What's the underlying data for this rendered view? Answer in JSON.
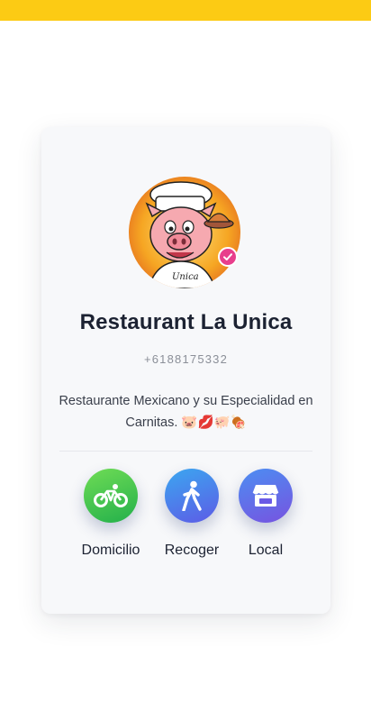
{
  "restaurant": {
    "name": "Restaurant La Unica",
    "phone": "+6188175332",
    "description": "Restaurante Mexicano y su Especialidad en Carnitas. 🐷💋🐖🍖",
    "logo_text": "Unica",
    "verified_icon": "check-badge-icon"
  },
  "actions": [
    {
      "label": "Domicilio",
      "icon": "bicycle-icon",
      "color": "#23b04b"
    },
    {
      "label": "Recoger",
      "icon": "walking-person-icon",
      "color": "#3ba7f0"
    },
    {
      "label": "Local",
      "icon": "storefront-icon",
      "color": "#6a5ae6"
    }
  ],
  "colors": {
    "top_bar": "#fccb14",
    "card_bg": "#f7f8fa",
    "verified": "#e83e8c"
  }
}
